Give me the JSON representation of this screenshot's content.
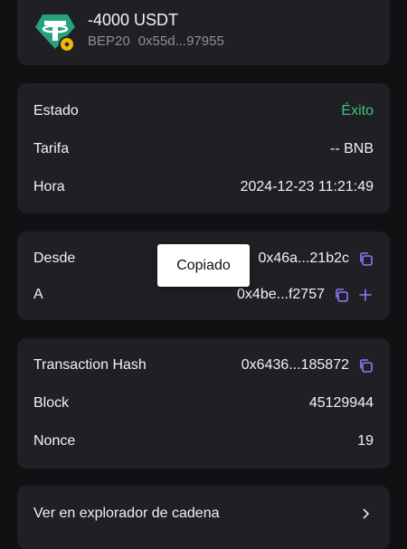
{
  "header": {
    "amount": "-4000 USDT",
    "network": "BEP20",
    "address": "0x55d...97955"
  },
  "status_card": {
    "status_label": "Estado",
    "status_value": "Éxito",
    "fee_label": "Tarifa",
    "fee_value": "-- BNB",
    "time_label": "Hora",
    "time_value": "2024-12-23 11:21:49"
  },
  "parties_card": {
    "from_label": "Desde",
    "from_value": "0x46a...21b2c",
    "to_label": "A",
    "to_value": "0x4be...f2757"
  },
  "tx_card": {
    "hash_label": "Transaction Hash",
    "hash_value": "0x6436...185872",
    "block_label": "Block",
    "block_value": "45129944",
    "nonce_label": "Nonce",
    "nonce_value": "19"
  },
  "explorer": {
    "label": "Ver en explorador de cadena"
  },
  "toast": {
    "text": "Copiado"
  },
  "colors": {
    "success": "#3ec47c",
    "accent": "#8a7cff",
    "tether": "#26a17b",
    "bnb_badge": "#f0b90b"
  },
  "icons": [
    "tether-icon",
    "bnb-badge-icon",
    "copy-icon",
    "add-contact-icon",
    "chevron-right-icon"
  ]
}
